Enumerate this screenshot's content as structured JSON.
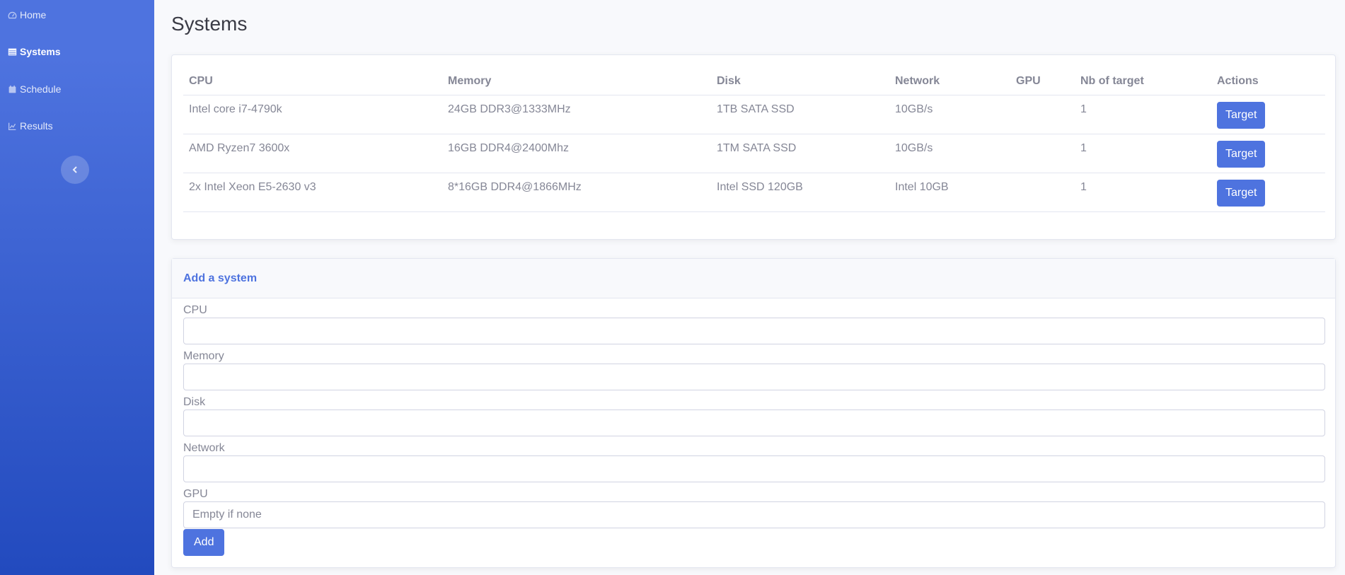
{
  "sidebar": {
    "items": [
      {
        "label": "Home",
        "icon": "tachometer-icon",
        "active": false
      },
      {
        "label": "Systems",
        "icon": "table-icon",
        "active": true
      },
      {
        "label": "Schedule",
        "icon": "calendar-icon",
        "active": false
      },
      {
        "label": "Results",
        "icon": "chart-icon",
        "active": false
      }
    ],
    "toggle_icon": "chevron-left-icon"
  },
  "page": {
    "title": "Systems"
  },
  "table": {
    "headers": [
      "CPU",
      "Memory",
      "Disk",
      "Network",
      "GPU",
      "Nb of target",
      "Actions"
    ],
    "rows": [
      {
        "cpu": "Intel core i7-4790k",
        "memory": "24GB DDR3@1333MHz",
        "disk": "1TB SATA SSD",
        "network": "10GB/s",
        "gpu": "",
        "nb_target": "1",
        "action": "Target"
      },
      {
        "cpu": "AMD Ryzen7 3600x",
        "memory": "16GB DDR4@2400Mhz",
        "disk": "1TM SATA SSD",
        "network": "10GB/s",
        "gpu": "",
        "nb_target": "1",
        "action": "Target"
      },
      {
        "cpu": "2x Intel Xeon E5-2630 v3",
        "memory": "8*16GB DDR4@1866MHz",
        "disk": "Intel SSD 120GB",
        "network": "Intel 10GB",
        "gpu": "",
        "nb_target": "1",
        "action": "Target"
      }
    ]
  },
  "form": {
    "title": "Add a system",
    "fields": [
      {
        "label": "CPU",
        "value": "",
        "placeholder": ""
      },
      {
        "label": "Memory",
        "value": "",
        "placeholder": ""
      },
      {
        "label": "Disk",
        "value": "",
        "placeholder": ""
      },
      {
        "label": "Network",
        "value": "",
        "placeholder": ""
      },
      {
        "label": "GPU",
        "value": "",
        "placeholder": "Empty if none"
      }
    ],
    "submit_label": "Add"
  },
  "colors": {
    "primary": "#4e73df",
    "sidebar_end": "#224abe",
    "text": "#858796"
  }
}
